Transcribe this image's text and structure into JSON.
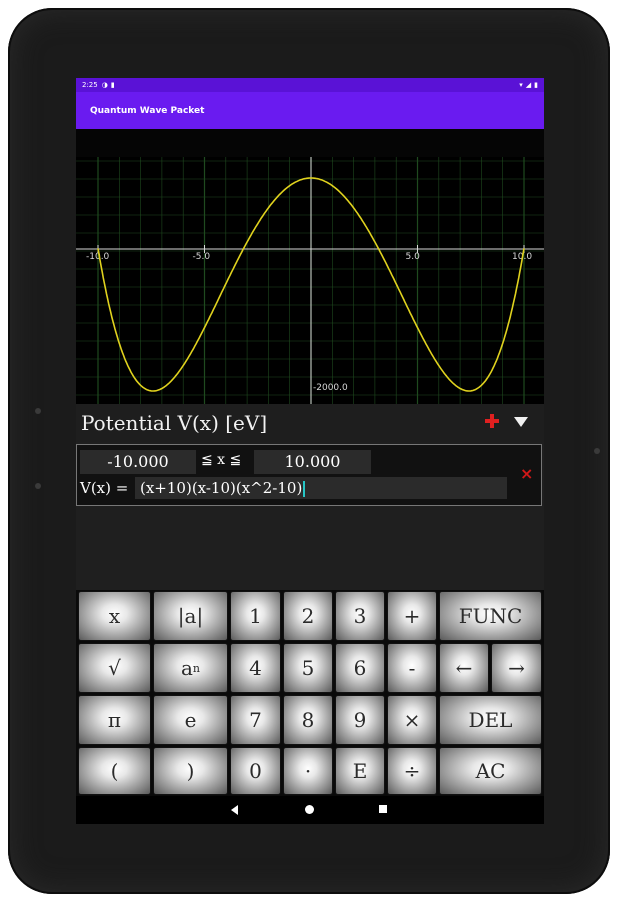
{
  "statusbar": {
    "time": "2:25"
  },
  "app": {
    "title": "Quantum Wave Packet"
  },
  "graph": {
    "x_ticks": [
      "-10.0",
      "-5.0",
      "5.0",
      "10.0"
    ],
    "y_label": "-2000.0",
    "curve_color": "#e0d21e",
    "grid_color": "#1f4a1f"
  },
  "panel": {
    "title": "Potential V(x) [eV]",
    "add_color": "#e02020"
  },
  "range": {
    "min": "-10.000",
    "ineq": "≦ x ≦",
    "max": "10.000"
  },
  "func": {
    "label": "V(x) =",
    "expr": "(x+10)(x-10)(x^2-10)"
  },
  "clear_label": "×",
  "keys": {
    "r1": [
      "x",
      "|a|",
      "1",
      "2",
      "3",
      "+",
      "FUNC"
    ],
    "r2a": [
      "√",
      "a",
      "4",
      "5",
      "6",
      "-",
      "←",
      "→"
    ],
    "r2_sup": "n",
    "r3": [
      "π",
      "e",
      "7",
      "8",
      "9",
      "×",
      "DEL"
    ],
    "r4": [
      "(",
      ")",
      "0",
      "·",
      "E",
      "÷",
      "AC"
    ]
  },
  "chart_data": {
    "type": "line",
    "function": "(x+10)(x-10)(x^2-10)",
    "x_range": [
      -10,
      10
    ],
    "tick_labels": [
      "-10.0",
      "-5.0",
      "5.0",
      "10.0"
    ],
    "annotation": "-2000.0",
    "grid": true
  }
}
